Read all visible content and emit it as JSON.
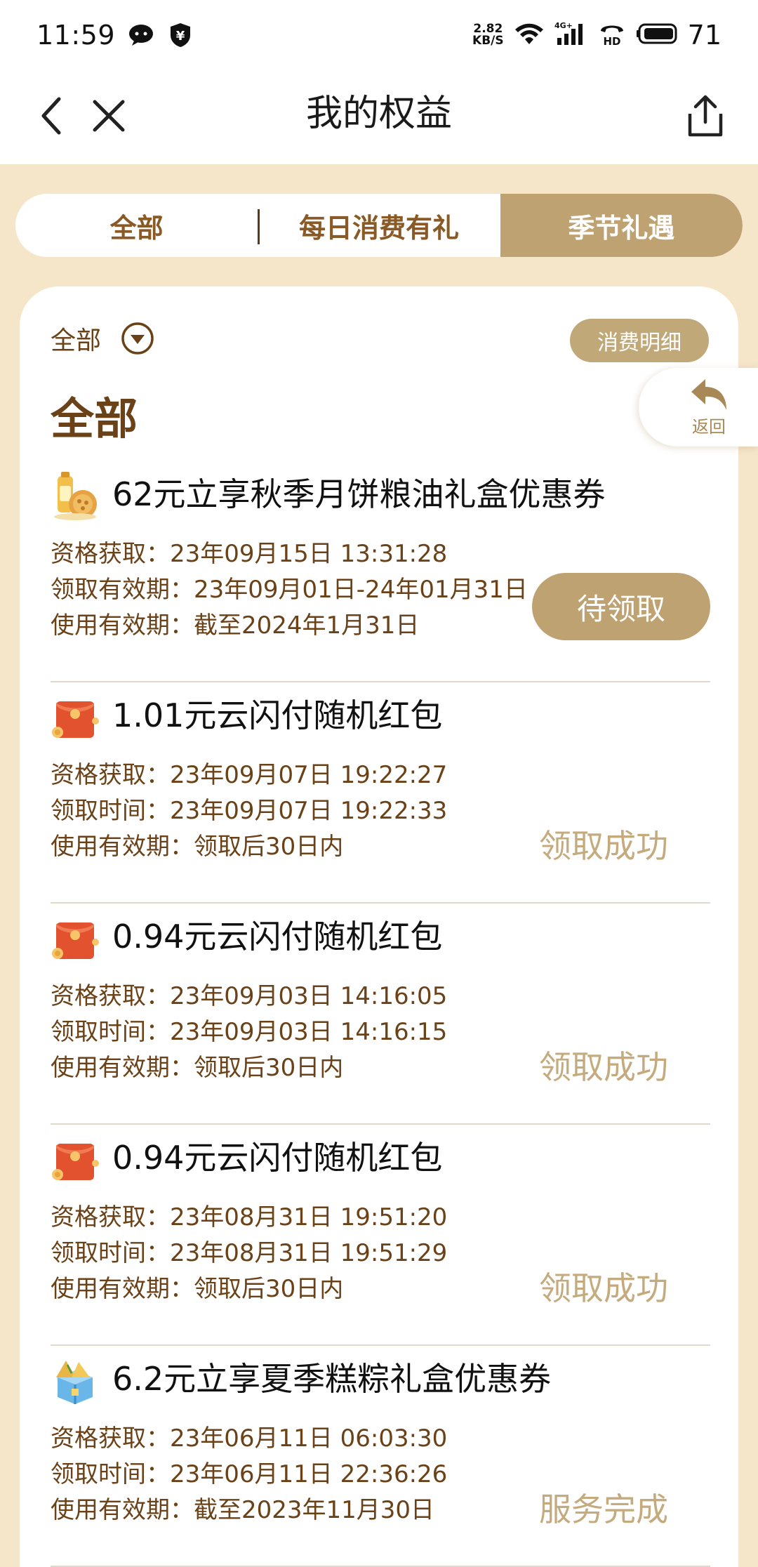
{
  "status_bar": {
    "time": "11:59",
    "net_speed_value": "2.82",
    "net_speed_unit": "KB/S",
    "signal_tag": "4G+",
    "hd_tag": "HD",
    "battery": "71"
  },
  "header": {
    "title": "我的权益"
  },
  "tabs": [
    {
      "label": "全部",
      "active": false
    },
    {
      "label": "每日消费有礼",
      "active": false
    },
    {
      "label": "季节礼遇",
      "active": true
    }
  ],
  "filter": {
    "label": "全部"
  },
  "detail_button": "消费明细",
  "section_title": "全部",
  "float_return": "返回",
  "entries": [
    {
      "icon": "mooncake-oil-gift-icon",
      "name": "62元立享秋季月饼粮油礼盒优惠券",
      "lines": [
        "资格获取：23年09月15日 13:31:28",
        "领取有效期：23年09月01日-24年01月31日",
        "使用有效期：截至2024年1月31日"
      ],
      "action": "待领取"
    },
    {
      "icon": "red-packet-icon",
      "name": "1.01元云闪付随机红包",
      "lines": [
        "资格获取：23年09月07日 19:22:27",
        "领取时间：23年09月07日 19:22:33",
        "使用有效期：领取后30日内"
      ],
      "status": "领取成功"
    },
    {
      "icon": "red-packet-icon",
      "name": "0.94元云闪付随机红包",
      "lines": [
        "资格获取：23年09月03日 14:16:05",
        "领取时间：23年09月03日 14:16:15",
        "使用有效期：领取后30日内"
      ],
      "status": "领取成功"
    },
    {
      "icon": "red-packet-icon",
      "name": "0.94元云闪付随机红包",
      "lines": [
        "资格获取：23年08月31日 19:51:20",
        "领取时间：23年08月31日 19:51:29",
        "使用有效期：领取后30日内"
      ],
      "status": "领取成功"
    },
    {
      "icon": "zongzi-gift-box-icon",
      "name": "6.2元立享夏季糕粽礼盒优惠券",
      "lines": [
        "资格获取：23年06月11日 06:03:30",
        "领取时间：23年06月11日 22:36:26",
        "使用有效期：截至2023年11月30日"
      ],
      "status": "服务完成"
    }
  ],
  "colors": {
    "page_bg": "#f5e5c9",
    "accent_gold": "#bfa272",
    "brown_text": "#6b4218",
    "status_gold": "#c4aa7d"
  }
}
